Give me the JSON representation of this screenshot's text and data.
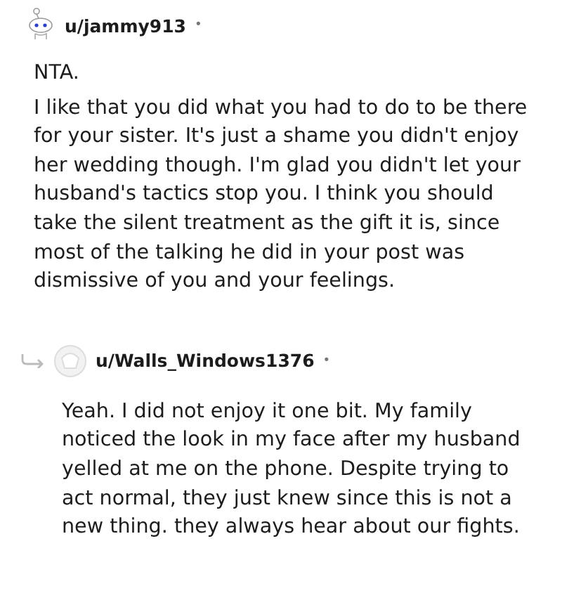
{
  "comments": [
    {
      "kind": "top",
      "username": "u/jammy913",
      "separator": "•",
      "paragraphs": [
        "NTA.",
        "I like that you did what you had to do to be there for your sister. It's just a shame you didn't enjoy her wedding though. I'm glad you didn't let your husband's tactics stop you. I think you should take the silent treatment as the gift it is, since most of the talking he did in your post was dismissive of you and your feelings."
      ]
    },
    {
      "kind": "reply",
      "username": "u/Walls_Windows1376",
      "separator": "•",
      "paragraphs": [
        "Yeah. I did not enjoy it one bit. My family noticed the look in my face after my husband yelled at me on the phone. Despite trying to act normal, they just knew since this is not a new thing. they always hear about our fights."
      ]
    }
  ]
}
